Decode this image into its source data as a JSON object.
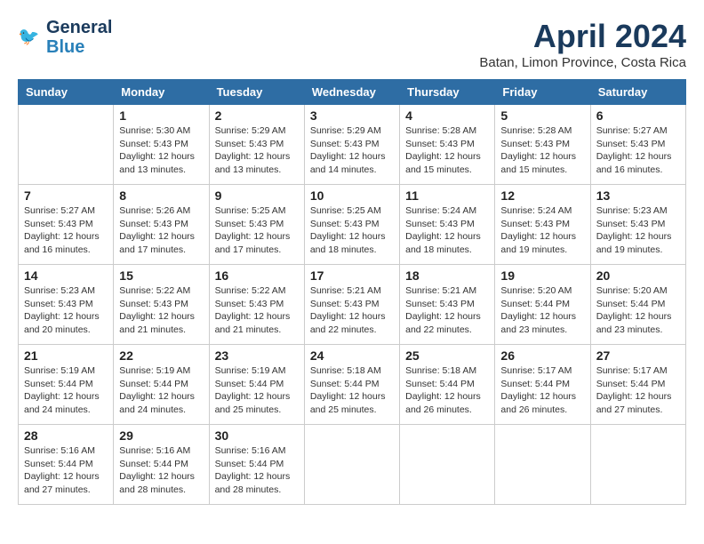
{
  "logo": {
    "line1": "General",
    "line2": "Blue"
  },
  "title": "April 2024",
  "subtitle": "Batan, Limon Province, Costa Rica",
  "days_header": [
    "Sunday",
    "Monday",
    "Tuesday",
    "Wednesday",
    "Thursday",
    "Friday",
    "Saturday"
  ],
  "weeks": [
    [
      {
        "day": "",
        "info": ""
      },
      {
        "day": "1",
        "info": "Sunrise: 5:30 AM\nSunset: 5:43 PM\nDaylight: 12 hours\nand 13 minutes."
      },
      {
        "day": "2",
        "info": "Sunrise: 5:29 AM\nSunset: 5:43 PM\nDaylight: 12 hours\nand 13 minutes."
      },
      {
        "day": "3",
        "info": "Sunrise: 5:29 AM\nSunset: 5:43 PM\nDaylight: 12 hours\nand 14 minutes."
      },
      {
        "day": "4",
        "info": "Sunrise: 5:28 AM\nSunset: 5:43 PM\nDaylight: 12 hours\nand 15 minutes."
      },
      {
        "day": "5",
        "info": "Sunrise: 5:28 AM\nSunset: 5:43 PM\nDaylight: 12 hours\nand 15 minutes."
      },
      {
        "day": "6",
        "info": "Sunrise: 5:27 AM\nSunset: 5:43 PM\nDaylight: 12 hours\nand 16 minutes."
      }
    ],
    [
      {
        "day": "7",
        "info": "Sunrise: 5:27 AM\nSunset: 5:43 PM\nDaylight: 12 hours\nand 16 minutes."
      },
      {
        "day": "8",
        "info": "Sunrise: 5:26 AM\nSunset: 5:43 PM\nDaylight: 12 hours\nand 17 minutes."
      },
      {
        "day": "9",
        "info": "Sunrise: 5:25 AM\nSunset: 5:43 PM\nDaylight: 12 hours\nand 17 minutes."
      },
      {
        "day": "10",
        "info": "Sunrise: 5:25 AM\nSunset: 5:43 PM\nDaylight: 12 hours\nand 18 minutes."
      },
      {
        "day": "11",
        "info": "Sunrise: 5:24 AM\nSunset: 5:43 PM\nDaylight: 12 hours\nand 18 minutes."
      },
      {
        "day": "12",
        "info": "Sunrise: 5:24 AM\nSunset: 5:43 PM\nDaylight: 12 hours\nand 19 minutes."
      },
      {
        "day": "13",
        "info": "Sunrise: 5:23 AM\nSunset: 5:43 PM\nDaylight: 12 hours\nand 19 minutes."
      }
    ],
    [
      {
        "day": "14",
        "info": "Sunrise: 5:23 AM\nSunset: 5:43 PM\nDaylight: 12 hours\nand 20 minutes."
      },
      {
        "day": "15",
        "info": "Sunrise: 5:22 AM\nSunset: 5:43 PM\nDaylight: 12 hours\nand 21 minutes."
      },
      {
        "day": "16",
        "info": "Sunrise: 5:22 AM\nSunset: 5:43 PM\nDaylight: 12 hours\nand 21 minutes."
      },
      {
        "day": "17",
        "info": "Sunrise: 5:21 AM\nSunset: 5:43 PM\nDaylight: 12 hours\nand 22 minutes."
      },
      {
        "day": "18",
        "info": "Sunrise: 5:21 AM\nSunset: 5:43 PM\nDaylight: 12 hours\nand 22 minutes."
      },
      {
        "day": "19",
        "info": "Sunrise: 5:20 AM\nSunset: 5:44 PM\nDaylight: 12 hours\nand 23 minutes."
      },
      {
        "day": "20",
        "info": "Sunrise: 5:20 AM\nSunset: 5:44 PM\nDaylight: 12 hours\nand 23 minutes."
      }
    ],
    [
      {
        "day": "21",
        "info": "Sunrise: 5:19 AM\nSunset: 5:44 PM\nDaylight: 12 hours\nand 24 minutes."
      },
      {
        "day": "22",
        "info": "Sunrise: 5:19 AM\nSunset: 5:44 PM\nDaylight: 12 hours\nand 24 minutes."
      },
      {
        "day": "23",
        "info": "Sunrise: 5:19 AM\nSunset: 5:44 PM\nDaylight: 12 hours\nand 25 minutes."
      },
      {
        "day": "24",
        "info": "Sunrise: 5:18 AM\nSunset: 5:44 PM\nDaylight: 12 hours\nand 25 minutes."
      },
      {
        "day": "25",
        "info": "Sunrise: 5:18 AM\nSunset: 5:44 PM\nDaylight: 12 hours\nand 26 minutes."
      },
      {
        "day": "26",
        "info": "Sunrise: 5:17 AM\nSunset: 5:44 PM\nDaylight: 12 hours\nand 26 minutes."
      },
      {
        "day": "27",
        "info": "Sunrise: 5:17 AM\nSunset: 5:44 PM\nDaylight: 12 hours\nand 27 minutes."
      }
    ],
    [
      {
        "day": "28",
        "info": "Sunrise: 5:16 AM\nSunset: 5:44 PM\nDaylight: 12 hours\nand 27 minutes."
      },
      {
        "day": "29",
        "info": "Sunrise: 5:16 AM\nSunset: 5:44 PM\nDaylight: 12 hours\nand 28 minutes."
      },
      {
        "day": "30",
        "info": "Sunrise: 5:16 AM\nSunset: 5:44 PM\nDaylight: 12 hours\nand 28 minutes."
      },
      {
        "day": "",
        "info": ""
      },
      {
        "day": "",
        "info": ""
      },
      {
        "day": "",
        "info": ""
      },
      {
        "day": "",
        "info": ""
      }
    ]
  ]
}
